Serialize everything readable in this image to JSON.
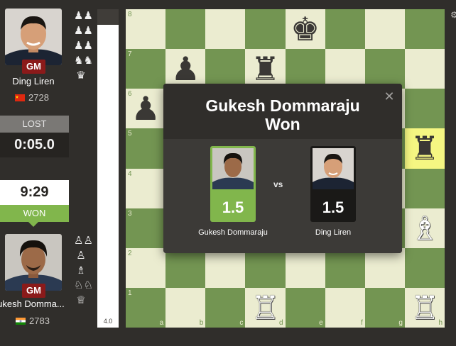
{
  "top_player": {
    "name": "Ding Liren",
    "title": "GM",
    "rating": "2728",
    "status": "LOST",
    "clock": "0:05.0",
    "flag": "china-flag"
  },
  "bottom_player": {
    "name": "Gukesh Domma...",
    "title": "GM",
    "rating": "2783",
    "status": "WON",
    "clock": "9:29",
    "flag": "india-flag"
  },
  "top_captured_icons": [
    "pawn-pair-icon",
    "pawn-pair-icon",
    "pawn-pair-icon",
    "knight-pair-icon",
    "queen-icon"
  ],
  "bottom_captured_icons": [
    "pawn-pair-icon",
    "pawn-icon",
    "bishop-icon",
    "knight-pair-icon",
    "queen-icon"
  ],
  "evaluation": {
    "score": "4.0"
  },
  "board": {
    "ranks": [
      "8",
      "7",
      "6",
      "5",
      "4",
      "3",
      "2",
      "1"
    ],
    "files": [
      "a",
      "b",
      "c",
      "d",
      "e",
      "f",
      "g",
      "h"
    ],
    "highlighted": [
      "h5"
    ],
    "pieces": {
      "e8": {
        "glyph": "♚",
        "color": "black",
        "name": "black-king-icon"
      },
      "b7": {
        "glyph": "♟",
        "color": "black",
        "name": "black-pawn-icon"
      },
      "d7": {
        "glyph": "♜",
        "color": "black",
        "name": "black-rook-icon"
      },
      "a6": {
        "glyph": "♟",
        "color": "black",
        "name": "black-pawn-icon"
      },
      "h5": {
        "glyph": "♜",
        "color": "black",
        "name": "black-rook-icon"
      },
      "h3": {
        "glyph": "♗",
        "color": "white",
        "name": "white-bishop-icon"
      },
      "d1": {
        "glyph": "♖",
        "color": "white",
        "name": "white-rook-icon"
      },
      "h1": {
        "glyph": "♖",
        "color": "white",
        "name": "white-rook-icon"
      }
    }
  },
  "result_modal": {
    "headline_line1": "Gukesh Dommaraju",
    "headline_line2": "Won",
    "close_glyph": "✕",
    "vs_label": "vs",
    "winner": {
      "name": "Gukesh Dommaraju",
      "score": "1.5"
    },
    "loser": {
      "name": "Ding Liren",
      "score": "1.5"
    }
  },
  "colors": {
    "board_light": "#ebecd0",
    "board_dark": "#739552",
    "highlight": "#f5f682",
    "won_green": "#81b64c",
    "title_badge": "#8b1a1a"
  }
}
